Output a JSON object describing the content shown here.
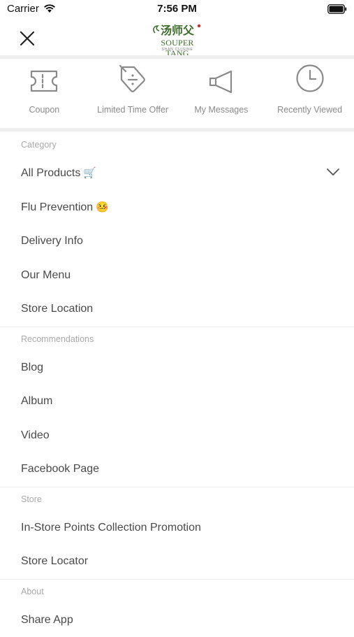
{
  "status_bar": {
    "carrier": "Carrier",
    "time": "7:56 PM"
  },
  "header": {
    "logo_cn": "汤师父",
    "logo_en": "SOUPER TANG",
    "logo_sub": "SHAN CUISINE"
  },
  "quick_links": [
    {
      "label": "Coupon",
      "icon": "coupon-icon"
    },
    {
      "label": "Limited Time Offer",
      "icon": "tag-icon"
    },
    {
      "label": "My Messages",
      "icon": "megaphone-icon"
    },
    {
      "label": "Recently Viewed",
      "icon": "clock-icon"
    }
  ],
  "sections": {
    "category": {
      "label": "Category",
      "items": [
        {
          "label": "All Products",
          "emoji": "🛒"
        },
        {
          "label": "Flu Prevention",
          "emoji": "🤒"
        },
        {
          "label": "Delivery Info"
        },
        {
          "label": "Our Menu"
        },
        {
          "label": "Store Location"
        }
      ]
    },
    "recommendations": {
      "label": "Recommendations",
      "items": [
        {
          "label": "Blog"
        },
        {
          "label": "Album"
        },
        {
          "label": "Video"
        },
        {
          "label": "Facebook Page"
        }
      ]
    },
    "store": {
      "label": "Store",
      "items": [
        {
          "label": "In-Store Points Collection Promotion"
        },
        {
          "label": "Store Locator"
        }
      ]
    },
    "about": {
      "label": "About",
      "items": [
        {
          "label": "Share App"
        }
      ]
    }
  },
  "colors": {
    "brand_green": "#3e6e2a",
    "brand_red": "#c8322a",
    "icon_gray": "#8a8a8a"
  }
}
